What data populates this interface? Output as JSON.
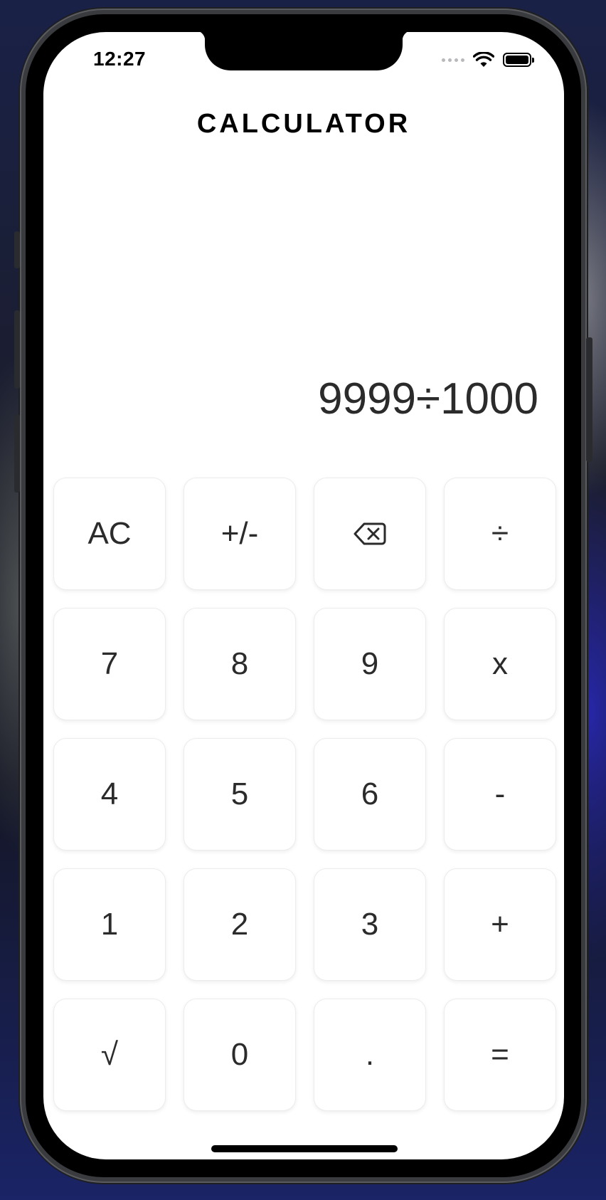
{
  "status_bar": {
    "time": "12:27",
    "icons": [
      "cellular-signal-icon",
      "wifi-icon",
      "battery-icon"
    ]
  },
  "app": {
    "title": "CALCULATOR"
  },
  "display": {
    "expression": "9999÷1000"
  },
  "keypad": {
    "rows": [
      [
        {
          "id": "clear",
          "label": "AC"
        },
        {
          "id": "negate",
          "label": "+/-"
        },
        {
          "id": "backspace",
          "label": "",
          "icon": "backspace-icon"
        },
        {
          "id": "divide",
          "label": "÷"
        }
      ],
      [
        {
          "id": "digit-7",
          "label": "7"
        },
        {
          "id": "digit-8",
          "label": "8"
        },
        {
          "id": "digit-9",
          "label": "9"
        },
        {
          "id": "multiply",
          "label": "x"
        }
      ],
      [
        {
          "id": "digit-4",
          "label": "4"
        },
        {
          "id": "digit-5",
          "label": "5"
        },
        {
          "id": "digit-6",
          "label": "6"
        },
        {
          "id": "subtract",
          "label": "-"
        }
      ],
      [
        {
          "id": "digit-1",
          "label": "1"
        },
        {
          "id": "digit-2",
          "label": "2"
        },
        {
          "id": "digit-3",
          "label": "3"
        },
        {
          "id": "add",
          "label": "+"
        }
      ],
      [
        {
          "id": "sqrt",
          "label": "√"
        },
        {
          "id": "digit-0",
          "label": "0"
        },
        {
          "id": "decimal",
          "label": "."
        },
        {
          "id": "equals",
          "label": "="
        }
      ]
    ]
  },
  "colors": {
    "screen_background": "#ffffff",
    "key_background": "#ffffff",
    "key_text": "#2b2b2b",
    "title_text": "#000000"
  }
}
